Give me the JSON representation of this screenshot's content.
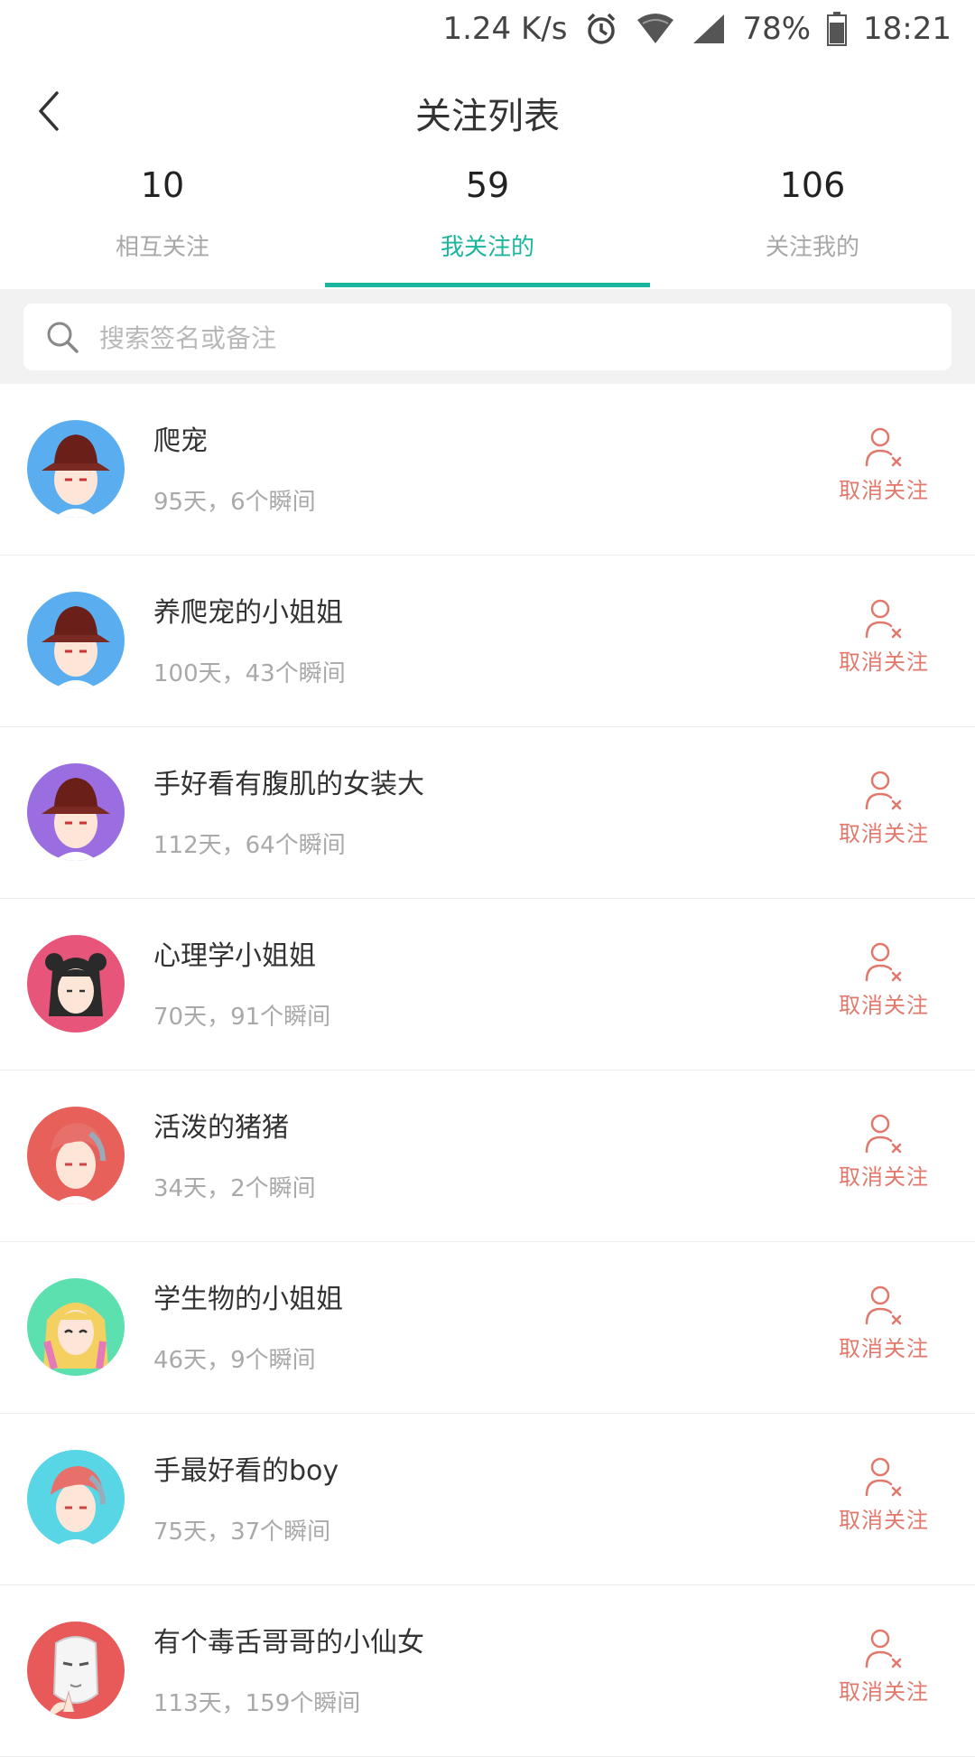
{
  "status_bar": {
    "speed": "1.24 K/s",
    "battery": "78%",
    "time": "18:21"
  },
  "header": {
    "title": "关注列表"
  },
  "tabs": [
    {
      "count": "10",
      "label": "相互关注"
    },
    {
      "count": "59",
      "label": "我关注的"
    },
    {
      "count": "106",
      "label": "关注我的"
    }
  ],
  "search": {
    "placeholder": "搜索签名或备注"
  },
  "unfollow_label": "取消关注",
  "accent_color": "#1bb59e",
  "unfollow_color": "#e2786c",
  "users": [
    {
      "name": "爬宠",
      "meta": "95天，6个瞬间",
      "avatar_bg": "#5aaef0",
      "avatar_style": "bucket-hat"
    },
    {
      "name": "养爬宠的小姐姐",
      "meta": "100天，43个瞬间",
      "avatar_bg": "#5aaef0",
      "avatar_style": "bucket-hat"
    },
    {
      "name": "手好看有腹肌的女装大",
      "meta": "112天，64个瞬间",
      "avatar_bg": "#9a6ee0",
      "avatar_style": "bucket-hat"
    },
    {
      "name": "心理学小姐姐",
      "meta": "70天，91个瞬间",
      "avatar_bg": "#e8557a",
      "avatar_style": "dark-hair-girl"
    },
    {
      "name": "活泼的猪猪",
      "meta": "34天，2个瞬间",
      "avatar_bg": "#e8605a",
      "avatar_style": "red-hair-boy"
    },
    {
      "name": "学生物的小姐姐",
      "meta": "46天，9个瞬间",
      "avatar_bg": "#5de0b0",
      "avatar_style": "blonde-girl"
    },
    {
      "name": "手最好看的boy",
      "meta": "75天，37个瞬间",
      "avatar_bg": "#58d6e6",
      "avatar_style": "red-hair-boy"
    },
    {
      "name": "有个毒舌哥哥的小仙女",
      "meta": "113天，159个瞬间",
      "avatar_bg": "#e85a5a",
      "avatar_style": "mask"
    }
  ]
}
